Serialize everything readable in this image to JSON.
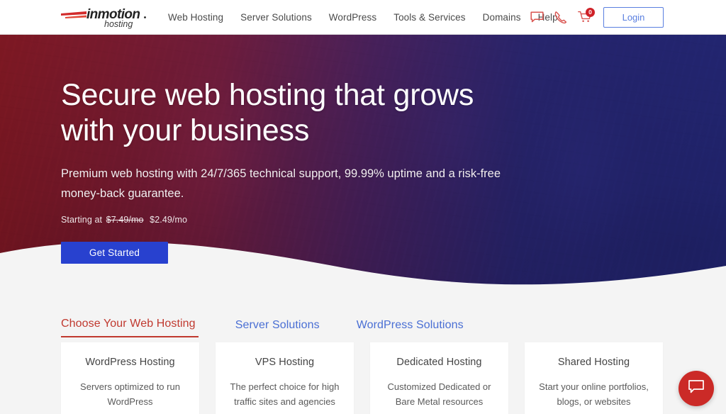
{
  "header": {
    "logo": {
      "brand": "inmotion",
      "tagline": "hosting",
      "alt": "inmotion hosting logo"
    },
    "nav": [
      {
        "label": "Web Hosting",
        "name": "nav-web-hosting"
      },
      {
        "label": "Server Solutions",
        "name": "nav-server-solutions"
      },
      {
        "label": "WordPress",
        "name": "nav-wordpress"
      },
      {
        "label": "Tools & Services",
        "name": "nav-tools-services"
      },
      {
        "label": "Domains",
        "name": "nav-domains"
      },
      {
        "label": "Help",
        "name": "nav-help"
      }
    ],
    "icons": [
      {
        "name": "chat-icon",
        "glyph": "chat-bubble"
      },
      {
        "name": "phone-icon",
        "glyph": "phone"
      },
      {
        "name": "cart-icon",
        "glyph": "shopping-cart"
      }
    ],
    "cart_count": "0",
    "login_label": "Login",
    "colors": {
      "accent_red": "#cf2127",
      "link_blue": "#5a7fe0",
      "nav_text": "#4a4a4a"
    }
  },
  "hero": {
    "title_line1": "Secure web hosting that grows",
    "title_line2": "with your business",
    "subtitle": "Premium web hosting with 24/7/365 technical support, 99.99% uptime and a risk-free money-back guarantee.",
    "price_prefix": "Starting at",
    "price_old": "$7.49/mo",
    "price_new": "$2.49/mo",
    "cta_label": "Get Started",
    "colors": {
      "gradient_start": "#b01c2a",
      "gradient_end": "#2d3196",
      "cta_blue": "#2841cf"
    }
  },
  "tabs": [
    {
      "label": "Choose Your Web Hosting",
      "name": "tab-choose-your-web-hosting",
      "active": true
    },
    {
      "label": "Server Solutions",
      "name": "tab-server-solutions",
      "active": false
    },
    {
      "label": "WordPress Solutions",
      "name": "tab-wordpress-solutions",
      "active": false
    }
  ],
  "cards": [
    {
      "title": "WordPress Hosting",
      "desc": "Servers optimized to run WordPress"
    },
    {
      "title": "VPS Hosting",
      "desc": "The perfect choice for high traffic sites and agencies"
    },
    {
      "title": "Dedicated Hosting",
      "desc": "Customized Dedicated or Bare Metal resources"
    },
    {
      "title": "Shared Hosting",
      "desc": "Start your online portfolios, blogs, or websites"
    }
  ],
  "chat_widget": {
    "name": "chat-fab",
    "label": "Live chat",
    "color": "#cb2a27"
  }
}
